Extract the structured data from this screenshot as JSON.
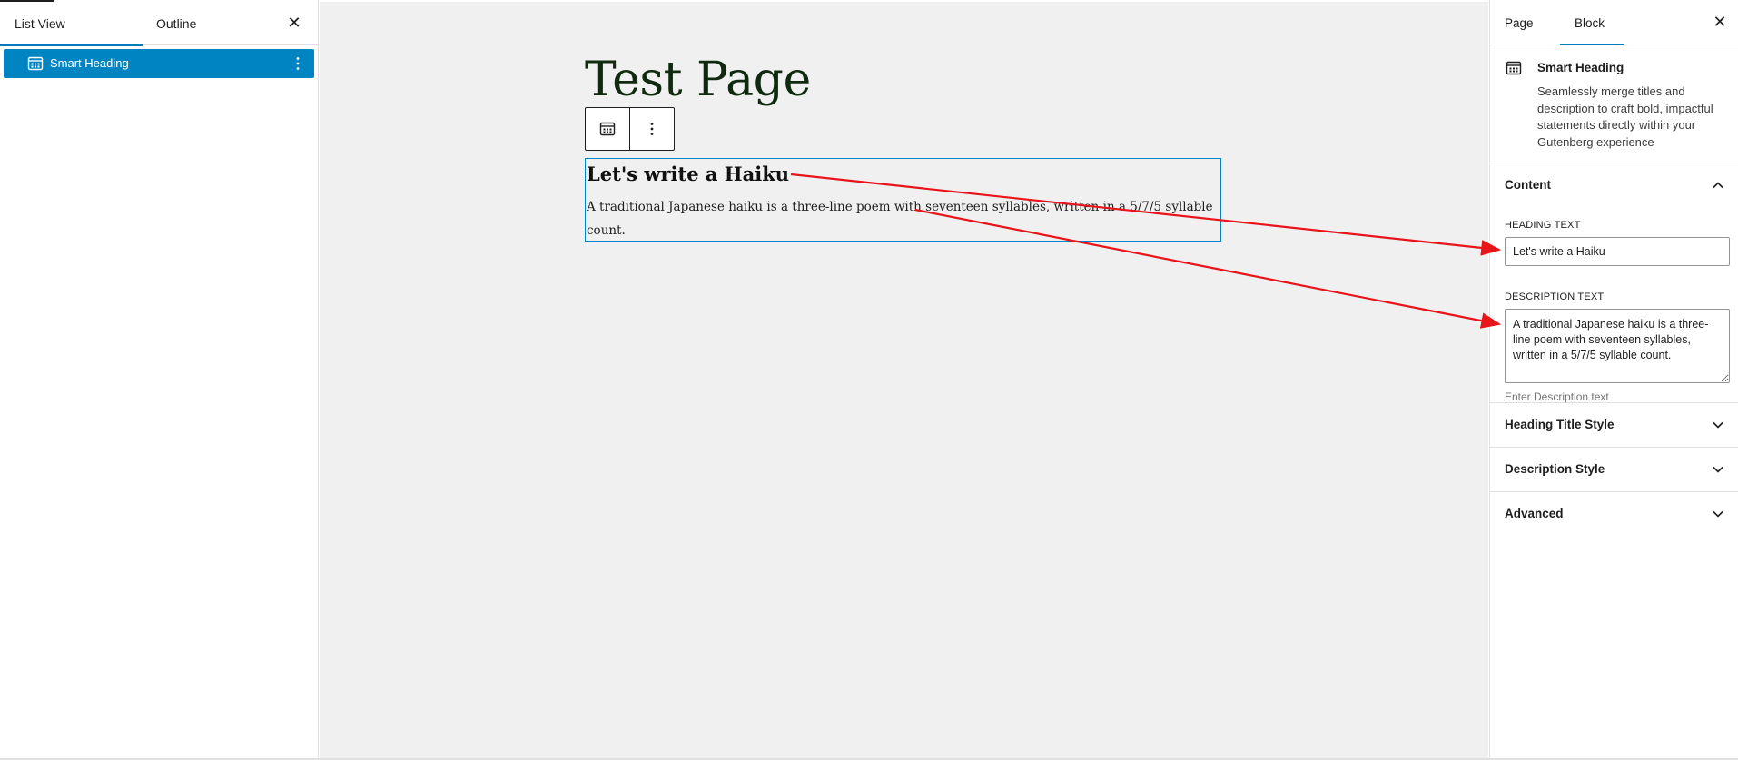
{
  "left_sidebar": {
    "tabs": [
      "List View",
      "Outline"
    ],
    "tree_items": [
      {
        "label": "Smart Heading",
        "icon": "table-grid-icon"
      }
    ]
  },
  "canvas": {
    "page_title": "Test Page",
    "block": {
      "heading": "Let's write a Haiku",
      "description": "A traditional Japanese haiku is a three-line poem with seventeen syllables, written in a 5/7/5 syllable count."
    }
  },
  "right_sidebar": {
    "tabs": [
      "Page",
      "Block"
    ],
    "block_card": {
      "title": "Smart Heading",
      "description": "Seamlessly merge titles and description to craft bold, impactful statements directly within your Gutenberg experience"
    },
    "content_panel": {
      "title": "Content",
      "heading_label": "HEADING TEXT",
      "heading_value": "Let's write a Haiku",
      "description_label": "DESCRIPTION TEXT",
      "description_value": "A traditional Japanese haiku is a three-line poem with seventeen syllables, written in a 5/7/5 syllable count.",
      "description_help": "Enter Description text"
    },
    "collapsed_panels": [
      "Heading Title Style",
      "Description Style",
      "Advanced"
    ]
  },
  "colors": {
    "accent": "#007cba",
    "selection": "#0085c2",
    "annotation_arrow": "#e8141a"
  }
}
